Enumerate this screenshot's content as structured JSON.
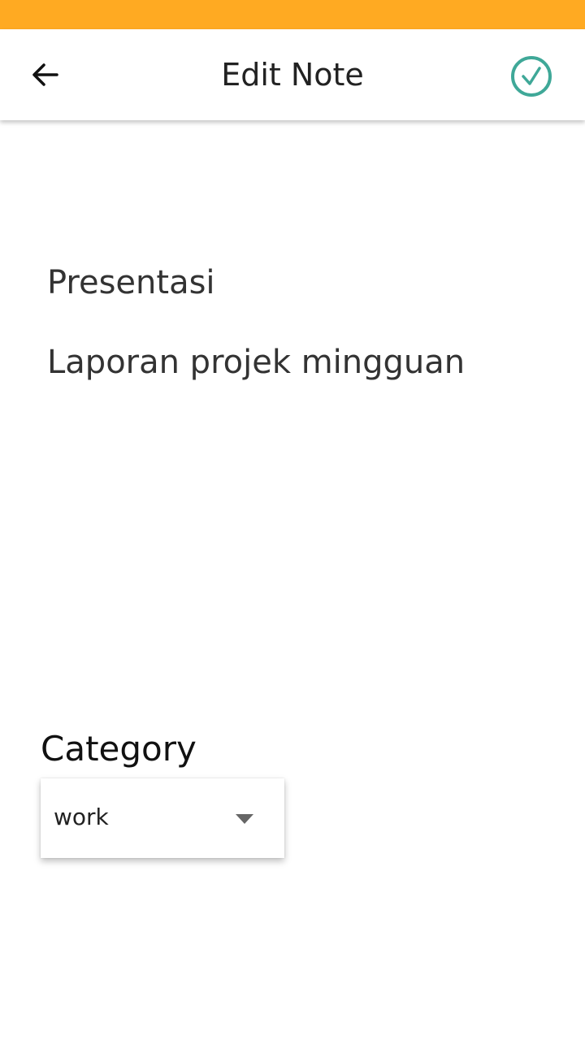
{
  "status_bar": {
    "color": "#FFAA22"
  },
  "app_bar": {
    "title": "Edit Note",
    "back_icon": "arrow-left-icon",
    "save_icon": "check-circle-icon",
    "save_icon_color": "#3FA898"
  },
  "note": {
    "title": "Presentasi",
    "body": "Laporan projek mingguan"
  },
  "category": {
    "label": "Category",
    "selected": "work"
  }
}
